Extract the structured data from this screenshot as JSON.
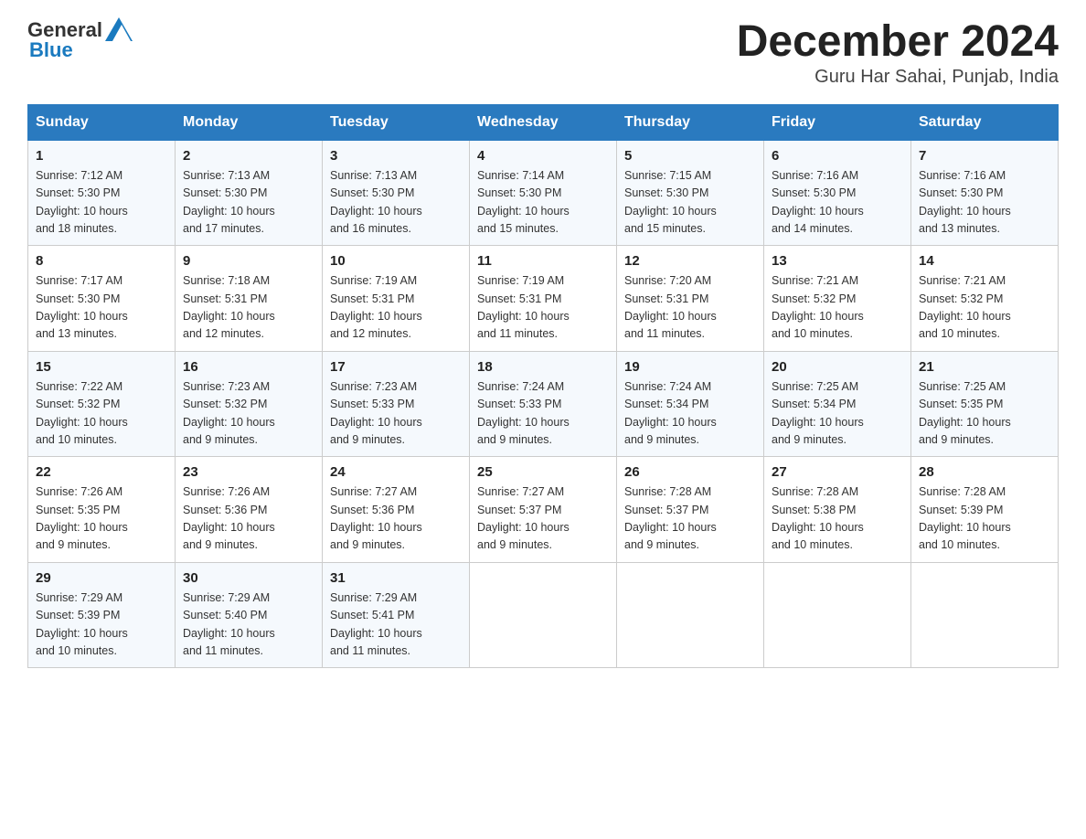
{
  "header": {
    "logo_text_general": "General",
    "logo_text_blue": "Blue",
    "title": "December 2024",
    "subtitle": "Guru Har Sahai, Punjab, India"
  },
  "days_of_week": [
    "Sunday",
    "Monday",
    "Tuesday",
    "Wednesday",
    "Thursday",
    "Friday",
    "Saturday"
  ],
  "weeks": [
    [
      {
        "day": "1",
        "sunrise": "7:12 AM",
        "sunset": "5:30 PM",
        "daylight": "10 hours and 18 minutes."
      },
      {
        "day": "2",
        "sunrise": "7:13 AM",
        "sunset": "5:30 PM",
        "daylight": "10 hours and 17 minutes."
      },
      {
        "day": "3",
        "sunrise": "7:13 AM",
        "sunset": "5:30 PM",
        "daylight": "10 hours and 16 minutes."
      },
      {
        "day": "4",
        "sunrise": "7:14 AM",
        "sunset": "5:30 PM",
        "daylight": "10 hours and 15 minutes."
      },
      {
        "day": "5",
        "sunrise": "7:15 AM",
        "sunset": "5:30 PM",
        "daylight": "10 hours and 15 minutes."
      },
      {
        "day": "6",
        "sunrise": "7:16 AM",
        "sunset": "5:30 PM",
        "daylight": "10 hours and 14 minutes."
      },
      {
        "day": "7",
        "sunrise": "7:16 AM",
        "sunset": "5:30 PM",
        "daylight": "10 hours and 13 minutes."
      }
    ],
    [
      {
        "day": "8",
        "sunrise": "7:17 AM",
        "sunset": "5:30 PM",
        "daylight": "10 hours and 13 minutes."
      },
      {
        "day": "9",
        "sunrise": "7:18 AM",
        "sunset": "5:31 PM",
        "daylight": "10 hours and 12 minutes."
      },
      {
        "day": "10",
        "sunrise": "7:19 AM",
        "sunset": "5:31 PM",
        "daylight": "10 hours and 12 minutes."
      },
      {
        "day": "11",
        "sunrise": "7:19 AM",
        "sunset": "5:31 PM",
        "daylight": "10 hours and 11 minutes."
      },
      {
        "day": "12",
        "sunrise": "7:20 AM",
        "sunset": "5:31 PM",
        "daylight": "10 hours and 11 minutes."
      },
      {
        "day": "13",
        "sunrise": "7:21 AM",
        "sunset": "5:32 PM",
        "daylight": "10 hours and 10 minutes."
      },
      {
        "day": "14",
        "sunrise": "7:21 AM",
        "sunset": "5:32 PM",
        "daylight": "10 hours and 10 minutes."
      }
    ],
    [
      {
        "day": "15",
        "sunrise": "7:22 AM",
        "sunset": "5:32 PM",
        "daylight": "10 hours and 10 minutes."
      },
      {
        "day": "16",
        "sunrise": "7:23 AM",
        "sunset": "5:32 PM",
        "daylight": "10 hours and 9 minutes."
      },
      {
        "day": "17",
        "sunrise": "7:23 AM",
        "sunset": "5:33 PM",
        "daylight": "10 hours and 9 minutes."
      },
      {
        "day": "18",
        "sunrise": "7:24 AM",
        "sunset": "5:33 PM",
        "daylight": "10 hours and 9 minutes."
      },
      {
        "day": "19",
        "sunrise": "7:24 AM",
        "sunset": "5:34 PM",
        "daylight": "10 hours and 9 minutes."
      },
      {
        "day": "20",
        "sunrise": "7:25 AM",
        "sunset": "5:34 PM",
        "daylight": "10 hours and 9 minutes."
      },
      {
        "day": "21",
        "sunrise": "7:25 AM",
        "sunset": "5:35 PM",
        "daylight": "10 hours and 9 minutes."
      }
    ],
    [
      {
        "day": "22",
        "sunrise": "7:26 AM",
        "sunset": "5:35 PM",
        "daylight": "10 hours and 9 minutes."
      },
      {
        "day": "23",
        "sunrise": "7:26 AM",
        "sunset": "5:36 PM",
        "daylight": "10 hours and 9 minutes."
      },
      {
        "day": "24",
        "sunrise": "7:27 AM",
        "sunset": "5:36 PM",
        "daylight": "10 hours and 9 minutes."
      },
      {
        "day": "25",
        "sunrise": "7:27 AM",
        "sunset": "5:37 PM",
        "daylight": "10 hours and 9 minutes."
      },
      {
        "day": "26",
        "sunrise": "7:28 AM",
        "sunset": "5:37 PM",
        "daylight": "10 hours and 9 minutes."
      },
      {
        "day": "27",
        "sunrise": "7:28 AM",
        "sunset": "5:38 PM",
        "daylight": "10 hours and 10 minutes."
      },
      {
        "day": "28",
        "sunrise": "7:28 AM",
        "sunset": "5:39 PM",
        "daylight": "10 hours and 10 minutes."
      }
    ],
    [
      {
        "day": "29",
        "sunrise": "7:29 AM",
        "sunset": "5:39 PM",
        "daylight": "10 hours and 10 minutes."
      },
      {
        "day": "30",
        "sunrise": "7:29 AM",
        "sunset": "5:40 PM",
        "daylight": "10 hours and 11 minutes."
      },
      {
        "day": "31",
        "sunrise": "7:29 AM",
        "sunset": "5:41 PM",
        "daylight": "10 hours and 11 minutes."
      },
      null,
      null,
      null,
      null
    ]
  ],
  "labels": {
    "sunrise": "Sunrise:",
    "sunset": "Sunset:",
    "daylight": "Daylight:"
  }
}
